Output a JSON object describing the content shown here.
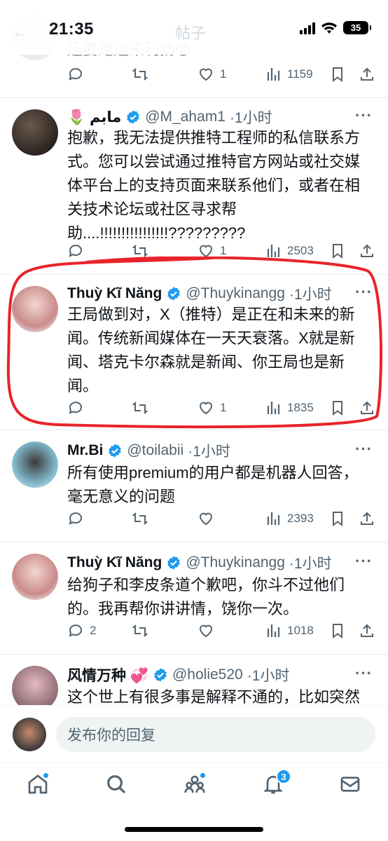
{
  "status_bar": {
    "time": "21:35",
    "battery": "35",
    "header_faded": "帖子"
  },
  "top_partial_tweet": {
    "text_fragment": "还要跑运来刊扬😊",
    "actions": {
      "likes": "1",
      "views": "1159"
    }
  },
  "tweets": [
    {
      "name": "🌷 مابم",
      "handle": "@M_aham1",
      "time": "·1小时",
      "text": "抱歉，我无法提供推特工程师的私信联系方式。您可以尝试通过推特官方网站或社交媒体平台上的支持页面来联系他们，或者在相关技术论坛或社区寻求帮助....!!!!!!!!!!!!!!!!?????????",
      "replies": "",
      "likes": "1",
      "views": "2503"
    },
    {
      "name": "Thuỳ Kĩ Năng",
      "handle": "@Thuykinangg",
      "time": "·1小时",
      "text": "王局做到对，X（推特）是正在和未来的新闻。传统新闻媒体在一天天衰落。X就是新闻、塔克卡尔森就是新闻、你王局也是新闻。",
      "replies": "",
      "likes": "1",
      "views": "1835"
    },
    {
      "name": "Mr.Bi",
      "handle": "@toilabii",
      "time": "·1小时",
      "text": "所有使用premium的用户都是机器人回答，毫无意义的问题",
      "replies": "",
      "likes": "",
      "views": "2393"
    },
    {
      "name": "Thuỳ Kĩ Năng",
      "handle": "@Thuykinangg",
      "time": "·1小时",
      "text": "给狗子和李皮条道个歉吧，你斗不过他们的。我再帮你讲讲情，饶你一次。",
      "replies": "2",
      "likes": "",
      "views": "1018"
    },
    {
      "name": "风情万种 💞",
      "handle": "@holie520",
      "time": "·1小时",
      "text": "这个世上有很多事是解释不通的，比如突然"
    }
  ],
  "reply_bar": {
    "placeholder": "发布你的回复"
  },
  "bottom_nav": {
    "notifications_badge": "3"
  },
  "colors": {
    "accent": "#1d9bf0",
    "muted": "#536471",
    "highlight": "#e8242a"
  }
}
